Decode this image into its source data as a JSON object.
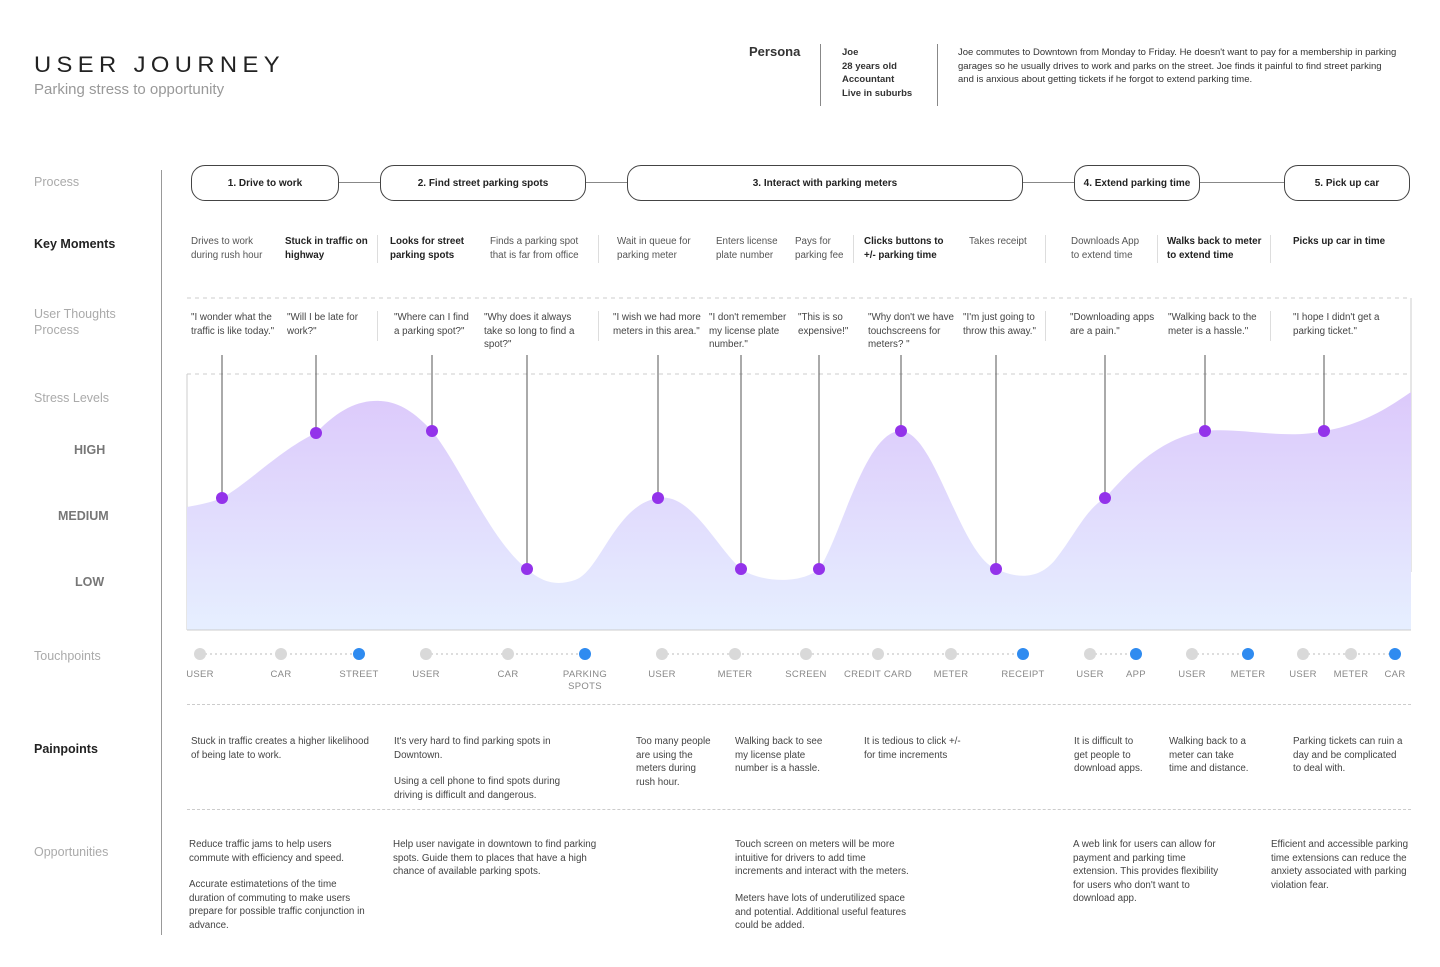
{
  "header": {
    "title": "USER JOURNEY",
    "subtitle": "Parking stress to opportunity"
  },
  "persona": {
    "heading": "Persona",
    "name": "Joe",
    "age": "28 years old",
    "job": "Accountant",
    "home": "Live in suburbs",
    "description": "Joe commutes to Downtown from Monday to Friday. He doesn't want to pay for a membership in parking garages so he usually drives to work and parks on the street.  Joe finds it painful to find street parking and is anxious about getting tickets if he forgot to extend parking time."
  },
  "row_labels": {
    "process": "Process",
    "key_moments": "Key Moments",
    "thoughts": "User Thoughts Process",
    "stress": "Stress Levels",
    "high": "HIGH",
    "medium": "MEDIUM",
    "low": "LOW",
    "touchpoints": "Touchpoints",
    "painpoints": "Painpoints",
    "opportunities": "Opportunities"
  },
  "process": [
    "1. Drive to work",
    "2. Find street parking spots",
    "3. Interact with parking meters",
    "4. Extend parking time",
    "5. Pick up car"
  ],
  "key_moments": [
    "Drives to work during rush hour",
    "Stuck in traffic on highway",
    "Looks for street parking spots",
    "Finds a parking spot that is far from office",
    "Wait in queue for parking meter",
    "Enters license plate number",
    "Pays for parking fee",
    "Clicks buttons to +/- parking time",
    "Takes receipt",
    "Downloads App to extend time",
    "Walks back to meter to extend time",
    "Picks up car in time"
  ],
  "thoughts": [
    "\"I wonder what the traffic is like today.\"",
    "\"Will I be late for work?\"",
    "\"Where can I find a parking spot?\"",
    "\"Why does it always take so long to find a spot?\"",
    "\"I wish we had more meters in this area.\"",
    "\"I don't remember my license plate number.\"",
    "\"This is so expensive!\"",
    "\"Why don't we have touchscreens for meters? \"",
    "\"I'm just going to throw this away.\"",
    "\"Downloading apps are a pain.\"",
    "\"Walking back to the meter is a hassle.\"",
    "\"I hope I didn't get a parking ticket.\""
  ],
  "stress_levels": [
    "MEDIUM",
    "HIGH",
    "HIGH",
    "LOW",
    "MEDIUM",
    "LOW",
    "LOW",
    "HIGH",
    "LOW",
    "MEDIUM",
    "HIGH",
    "HIGH"
  ],
  "touchpoints": [
    {
      "label": "USER",
      "active": false
    },
    {
      "label": "CAR",
      "active": false
    },
    {
      "label": "STREET",
      "active": true
    },
    {
      "label": "USER",
      "active": false
    },
    {
      "label": "CAR",
      "active": false
    },
    {
      "label": "PARKING SPOTS",
      "active": true
    },
    {
      "label": "USER",
      "active": false
    },
    {
      "label": "METER",
      "active": false
    },
    {
      "label": "SCREEN",
      "active": false
    },
    {
      "label": "CREDIT CARD",
      "active": false
    },
    {
      "label": "METER",
      "active": false
    },
    {
      "label": "RECEIPT",
      "active": true
    },
    {
      "label": "USER",
      "active": false
    },
    {
      "label": "APP",
      "active": true
    },
    {
      "label": "USER",
      "active": false
    },
    {
      "label": "METER",
      "active": true
    },
    {
      "label": "USER",
      "active": false
    },
    {
      "label": "METER",
      "active": false
    },
    {
      "label": "CAR",
      "active": true
    }
  ],
  "painpoints": [
    "Stuck in traffic creates a higher likelihood of being late to work.",
    "It's very hard to find parking spots in Downtown.",
    "Using a cell phone to find spots during driving is difficult and dangerous.",
    "Too many people are using the meters during rush hour.",
    "Walking back to see my license plate number is a hassle.",
    "It is tedious to click +/- for  time increments",
    "It is difficult to get people to download apps.",
    "Walking back to a meter can take time and distance.",
    "Parking tickets can ruin a day and be complicated to deal with."
  ],
  "opportunities": [
    "Reduce traffic jams to help users commute with efficiency and speed.",
    "Accurate estimatetions of the time duration of commuting to make users prepare for possible traffic conjunction in advance.",
    "Help user navigate in downtown to find parking spots. Guide them to places that have a high chance of available parking spots.",
    "Touch screen on meters will be more intuitive for drivers to add time increments and interact with the meters.",
    "Meters have lots of underutilized space and potential. Additional useful features could be added.",
    "A web link for users can allow for payment and parking time extension. This provides flexibility for users who don't want to download app.",
    "Efficient and accessible parking time extensions can reduce the anxiety associated with parking violation fear."
  ],
  "colors": {
    "stress_dot": "#9333ea",
    "stress_fill_top": "#dcc9fb",
    "stress_fill_bottom": "#e6efff",
    "touchpoint_active": "#2f8bf0",
    "touchpoint_inactive": "#d9d9d9"
  }
}
